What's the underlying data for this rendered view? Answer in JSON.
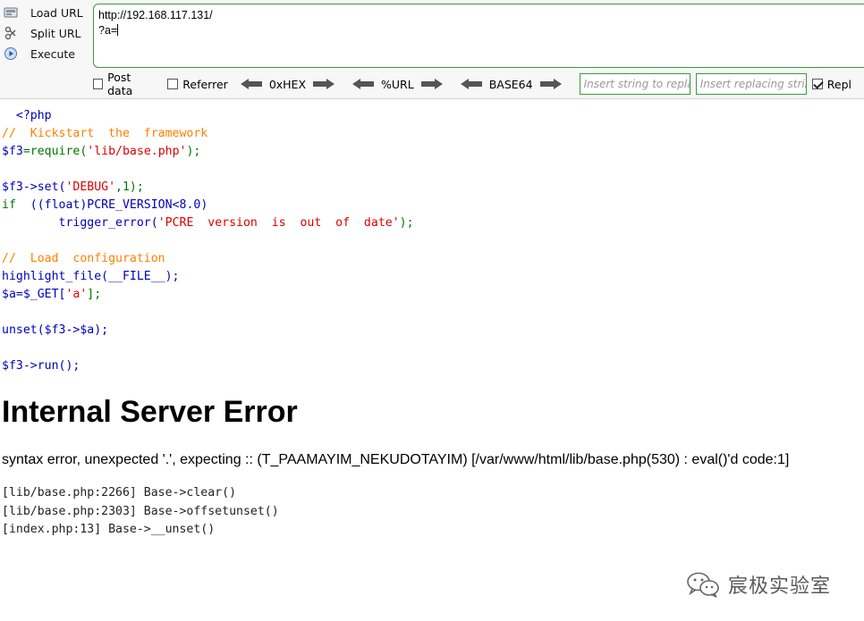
{
  "hackbar": {
    "buttons": [
      {
        "label": "Load URL",
        "icon": "load-url-icon"
      },
      {
        "label": "Split URL",
        "icon": "scissors-icon"
      },
      {
        "label": "Execute",
        "icon": "play-icon"
      }
    ],
    "url_lines": [
      "http://192.168.117.131/",
      "?a="
    ],
    "options": {
      "post_data": {
        "label": "Post data",
        "checked": false
      },
      "referrer": {
        "label": "Referrer",
        "checked": false
      },
      "replace": {
        "label": "Repl",
        "checked": true
      }
    },
    "codecs": [
      "0xHEX",
      "%URL",
      "BASE64"
    ],
    "insert_placeholder": "Insert string to replace",
    "replacing_placeholder": "Insert replacing string"
  },
  "source": {
    "open_tag": "<?php",
    "comment1": "//  Kickstart  the  framework",
    "line_require": {
      "var": "$f3",
      "op": "=require(",
      "str": "'lib/base.php'",
      "end": ");"
    },
    "line_set": {
      "pre": "$f3->set(",
      "str": "'DEBUG'",
      "end": ",1);"
    },
    "line_if": {
      "kw": "if",
      "rest": "  ((float)PCRE_VERSION<8.0)"
    },
    "line_trigger": {
      "indent": "        ",
      "fn": "trigger_error(",
      "str": "'PCRE  version  is  out  of  date'",
      "end": ");"
    },
    "comment2": "//  Load  configuration",
    "line_highlight": "highlight_file(__FILE__);",
    "line_get": {
      "pre": "$a=$_GET[",
      "str": "'a'",
      "end": "];"
    },
    "line_unset": "unset($f3->$a);",
    "line_run": "$f3->run();"
  },
  "error": {
    "title": "Internal Server Error",
    "message": "syntax error, unexpected '.', expecting :: (T_PAAMAYIM_NEKUDOTAYIM) [/var/www/html/lib/base.php(530) : eval()'d code:1]",
    "trace": [
      "[lib/base.php:2266] Base->clear()",
      "[lib/base.php:2303] Base->offsetunset()",
      "[index.php:13] Base->__unset()"
    ]
  },
  "watermark": {
    "text": "宸极实验室",
    "icon": "wechat-icon"
  },
  "colors": {
    "accent_green": "#3c9a3c",
    "comment": "#ff8000",
    "default": "#0000bb",
    "keyword": "#007700",
    "string": "#dd0000"
  }
}
